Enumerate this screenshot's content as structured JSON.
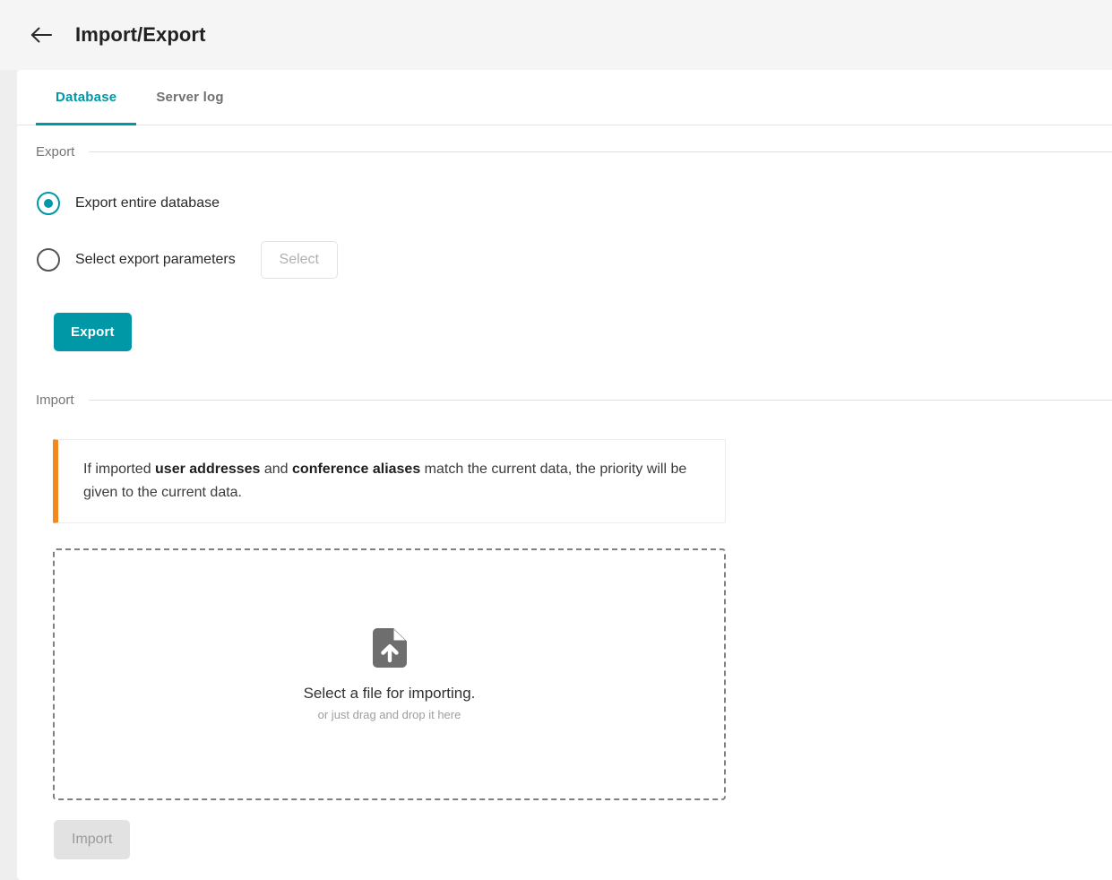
{
  "header": {
    "title": "Import/Export",
    "back_icon": "arrow-left-icon"
  },
  "tabs": [
    {
      "label": "Database",
      "active": true
    },
    {
      "label": "Server log",
      "active": false
    }
  ],
  "export_section": {
    "label": "Export",
    "options": [
      {
        "label": "Export entire database",
        "selected": true
      },
      {
        "label": "Select export parameters",
        "selected": false
      }
    ],
    "select_button": {
      "label": "Select",
      "disabled": true
    },
    "export_button": {
      "label": "Export",
      "disabled": false
    }
  },
  "import_section": {
    "label": "Import",
    "notice": {
      "prefix": "If imported ",
      "bold1": "user addresses",
      "middle": " and ",
      "bold2": "conference aliases",
      "suffix": " match the current data, the priority will be given to the current data.",
      "accent_color": "#f5871f"
    },
    "dropzone": {
      "icon": "file-upload-icon",
      "title": "Select a file for importing.",
      "subtitle": "or just drag and drop it here"
    },
    "import_button": {
      "label": "Import",
      "disabled": true
    }
  },
  "theme": {
    "accent": "#0097a7",
    "header_bg": "#f5f5f5",
    "page_bg": "#eeeeee",
    "muted_text": "#757575"
  }
}
